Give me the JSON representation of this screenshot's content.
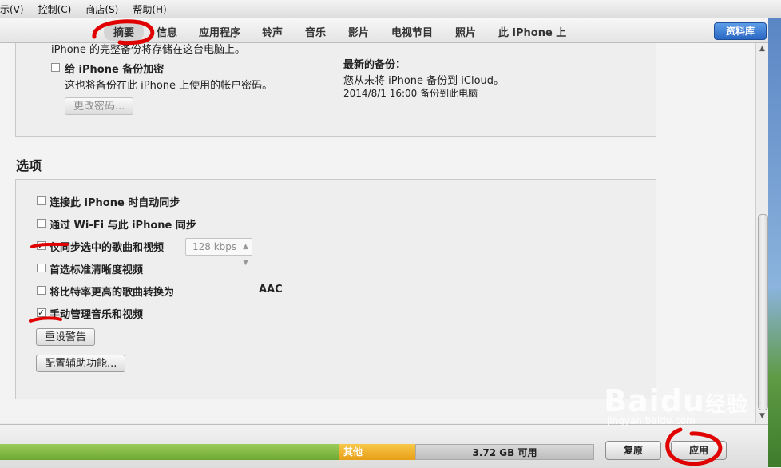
{
  "menu": [
    "示(V)",
    "控制(C)",
    "商店(S)",
    "帮助(H)"
  ],
  "tabs": [
    "摘要",
    "信息",
    "应用程序",
    "铃声",
    "音乐",
    "影片",
    "电视节目",
    "照片",
    "此 iPhone 上"
  ],
  "library_button": "资料库",
  "backup": {
    "cut_line": "iPhone 的完整备份将存储在这台电脑上。",
    "encrypt_label": "给 iPhone 备份加密",
    "encrypt_desc": "这也将备份在此 iPhone 上使用的帐户密码。",
    "change_password": "更改密码...",
    "latest_title": "最新的备份：",
    "latest_icloud": "您从未将 iPhone 备份到 iCloud。",
    "latest_pc": "2014/8/1  16:00 备份到此电脑"
  },
  "options": {
    "title": "选项",
    "items": [
      {
        "label": "连接此 iPhone 时自动同步",
        "checked": false
      },
      {
        "label": "通过 Wi-Fi 与此 iPhone 同步",
        "checked": false
      },
      {
        "label": "仅同步选中的歌曲和视频",
        "checked": true
      },
      {
        "label": "首选标准清晰度视频",
        "checked": false
      },
      {
        "label": "将比特率更高的歌曲转换为",
        "checked": false
      },
      {
        "label": "手动管理音乐和视频",
        "checked": true
      }
    ],
    "bitrate_value": "128 kbps",
    "bitrate_format": "AAC",
    "reset_warnings": "重设警告",
    "accessibility": "配置辅助功能..."
  },
  "storage": {
    "other_label": "其他",
    "free_label": "3.72 GB 可用"
  },
  "bottom_buttons": {
    "restore": "复原",
    "apply": "应用"
  },
  "watermark": {
    "brand": "Baidu",
    "brand_cn": "经验",
    "url": "jingyan.baidu.com"
  },
  "colors": {
    "accent_blue": "#2a67c2",
    "annotation_red": "#e00000",
    "storage_green": "#7db43d",
    "storage_other": "#f0b22e"
  }
}
